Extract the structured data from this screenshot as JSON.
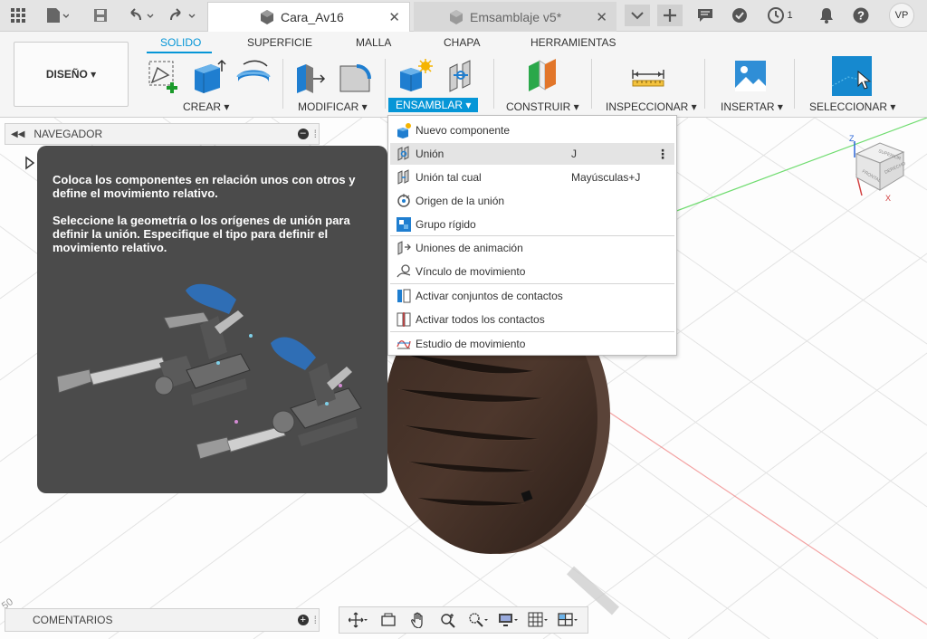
{
  "topbar": {
    "tabs": [
      {
        "name": "Cara_Av16",
        "active": true
      },
      {
        "name": "Emsamblaje v5*",
        "active": false
      }
    ],
    "notification_count": "1",
    "user_initials": "VP",
    "icons": [
      "grid-apps-icon",
      "file-icon",
      "save-icon",
      "undo-icon",
      "redo-icon",
      "close-icon",
      "chevron-down-icon",
      "plus-icon",
      "comments-icon",
      "offline-icon",
      "job-status-icon",
      "bell-icon",
      "help-icon"
    ]
  },
  "ribbon": {
    "workspace_button": "DISEÑO ▾",
    "tabs": [
      "SOLIDO",
      "SUPERFICIE",
      "MALLA",
      "CHAPA",
      "HERRAMIENTAS"
    ],
    "active_tab": "SOLIDO",
    "groups": [
      "CREAR ▾",
      "MODIFICAR ▾",
      "ENSAMBLAR ▾",
      "CONSTRUIR ▾",
      "INSPECCIONAR ▾",
      "INSERTAR ▾",
      "SELECCIONAR ▾"
    ],
    "active_group": "ENSAMBLAR ▾",
    "accent_color": "#0696d7"
  },
  "navigator": {
    "title": "NAVEGADOR"
  },
  "comments": {
    "title": "COMENTARIOS"
  },
  "tooltip": {
    "para1": "Coloca los componentes en relación unos con otros y define el movimiento relativo.",
    "para2": "Seleccione la geometría o los orígenes de unión para definir la unión. Especifique el tipo para definir el movimiento relativo."
  },
  "menu": {
    "items": [
      {
        "label": "Nuevo componente",
        "icon": "new-component-icon"
      },
      {
        "label": "Unión",
        "shortcut": "J",
        "icon": "joint-icon",
        "highlighted": true
      },
      {
        "label": "Unión tal cual",
        "shortcut": "Mayúsculas+J",
        "icon": "as-built-joint-icon"
      },
      {
        "label": "Origen de la unión",
        "icon": "joint-origin-icon"
      },
      {
        "label": "Grupo rígido",
        "icon": "rigid-group-icon"
      },
      {
        "label": "Uniones de animación",
        "icon": "drive-joints-icon"
      },
      {
        "label": "Vínculo de movimiento",
        "icon": "motion-link-icon"
      },
      {
        "label": "Activar conjuntos de contactos",
        "icon": "contact-sets-icon"
      },
      {
        "label": "Activar todos los contactos",
        "icon": "all-contacts-icon"
      },
      {
        "label": "Estudio de movimiento",
        "icon": "motion-study-icon"
      }
    ]
  },
  "viewcube": {
    "axis_z": "Z",
    "axis_x": "X"
  },
  "canvas": {
    "tick_label": "50"
  }
}
